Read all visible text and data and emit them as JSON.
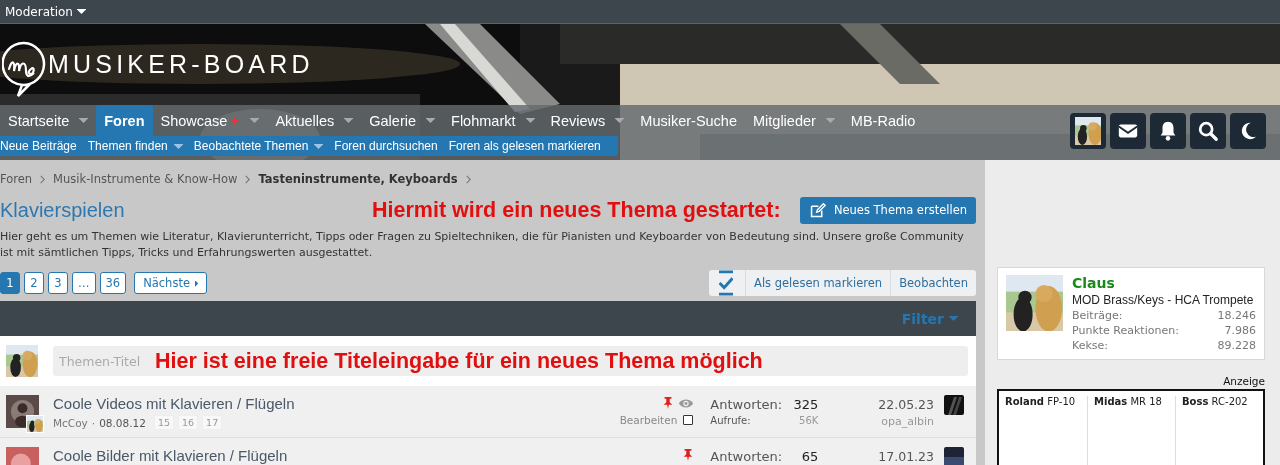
{
  "top_bar": {
    "menu": "Moderation"
  },
  "header": {
    "site_name": "MUSIKER-BOARD"
  },
  "nav": {
    "items": [
      {
        "label": "Startseite",
        "selected": false,
        "dropdown": true,
        "sparkle": false
      },
      {
        "label": "Foren",
        "selected": true,
        "dropdown": false,
        "sparkle": false
      },
      {
        "label": "Showcase",
        "selected": false,
        "dropdown": true,
        "sparkle": true
      },
      {
        "label": "Aktuelles",
        "selected": false,
        "dropdown": true,
        "sparkle": false
      },
      {
        "label": "Galerie",
        "selected": false,
        "dropdown": true,
        "sparkle": false
      },
      {
        "label": "Flohmarkt",
        "selected": false,
        "dropdown": true,
        "sparkle": false
      },
      {
        "label": "Reviews",
        "selected": false,
        "dropdown": true,
        "sparkle": false
      },
      {
        "label": "Musiker-Suche",
        "selected": false,
        "dropdown": false,
        "sparkle": false
      },
      {
        "label": "Mitglieder",
        "selected": false,
        "dropdown": true,
        "sparkle": false
      },
      {
        "label": "MB-Radio",
        "selected": false,
        "dropdown": false,
        "sparkle": false
      }
    ],
    "icons": [
      {
        "kind": "avatar"
      },
      {
        "kind": "mail"
      },
      {
        "kind": "bell"
      },
      {
        "kind": "search"
      },
      {
        "kind": "moon"
      }
    ]
  },
  "subnav": [
    {
      "label": "Neue Beiträge",
      "dropdown": false
    },
    {
      "label": "Themen finden",
      "dropdown": true
    },
    {
      "label": "Beobachtete Themen",
      "dropdown": true
    },
    {
      "label": "Foren durchsuchen",
      "dropdown": false
    },
    {
      "label": "Foren als gelesen markieren",
      "dropdown": false
    }
  ],
  "breadcrumbs": [
    {
      "label": "Foren",
      "current": false
    },
    {
      "label": "Musik-Instrumente & Know-How",
      "current": false
    },
    {
      "label": "Tasteninstrumente, Keyboards",
      "current": true
    }
  ],
  "forum": {
    "title": "Klavierspielen",
    "annotation": "Hiermit wird ein neues Thema gestartet:",
    "new_thread_button": "Neues Thema erstellen",
    "description": "Hier geht es um Themen wie Literatur, Klavierunterricht, Tipps oder Fragen zu Spieltechniken, die für Pianisten und Keyboarder von Bedeutung sind. Unsere große Community ist mit sämtlichen Tipps, Tricks und Erfahrungswerten ausgestattet."
  },
  "pagination": {
    "pages": [
      {
        "label": "1",
        "selected": true
      },
      {
        "label": "2",
        "selected": false
      },
      {
        "label": "3",
        "selected": false
      },
      {
        "label": "…",
        "selected": false
      },
      {
        "label": "36",
        "selected": false
      }
    ],
    "next": "Nächste"
  },
  "actions": [
    "Als gelesen markieren",
    "Beobachten"
  ],
  "filter_bar": {
    "label": "Filter"
  },
  "quick_thread": {
    "placeholder": "Themen-Titel",
    "annotation": "Hier ist eine freie Titeleingabe für ein neues Thema möglich"
  },
  "threads": [
    {
      "title": "Coole Videos mit Klavieren / Flügeln",
      "author": "McCoy",
      "separator": "·",
      "date": "08.08.12",
      "pages": [
        "15",
        "16",
        "17"
      ],
      "sticky": true,
      "watched": true,
      "edit_label": "Bearbeiten",
      "checked": false,
      "replies_label": "Antworten:",
      "replies": "325",
      "views_label": "Aufrufe:",
      "views": "56K",
      "last_date": "22.05.23",
      "last_user": "opa_albin"
    },
    {
      "title": "Coole Bilder mit Klavieren / Flügeln",
      "sticky": true,
      "watched": false,
      "replies_label": "Antworten:",
      "replies": "65",
      "last_date": "17.01.23"
    }
  ],
  "sidebar": {
    "member": {
      "name": "Claus",
      "role": "MOD Brass/Keys - HCA Trompete",
      "stats": [
        {
          "label": "Beiträge:",
          "value": "18.246"
        },
        {
          "label": "Punkte Reaktionen:",
          "value": "7.986"
        },
        {
          "label": "Kekse:",
          "value": "89.228"
        }
      ]
    },
    "ad": {
      "label": "Anzeige",
      "products": [
        "**Roland** FP-10",
        "**Midas** MR 18",
        "**Boss** RC-202"
      ]
    }
  }
}
